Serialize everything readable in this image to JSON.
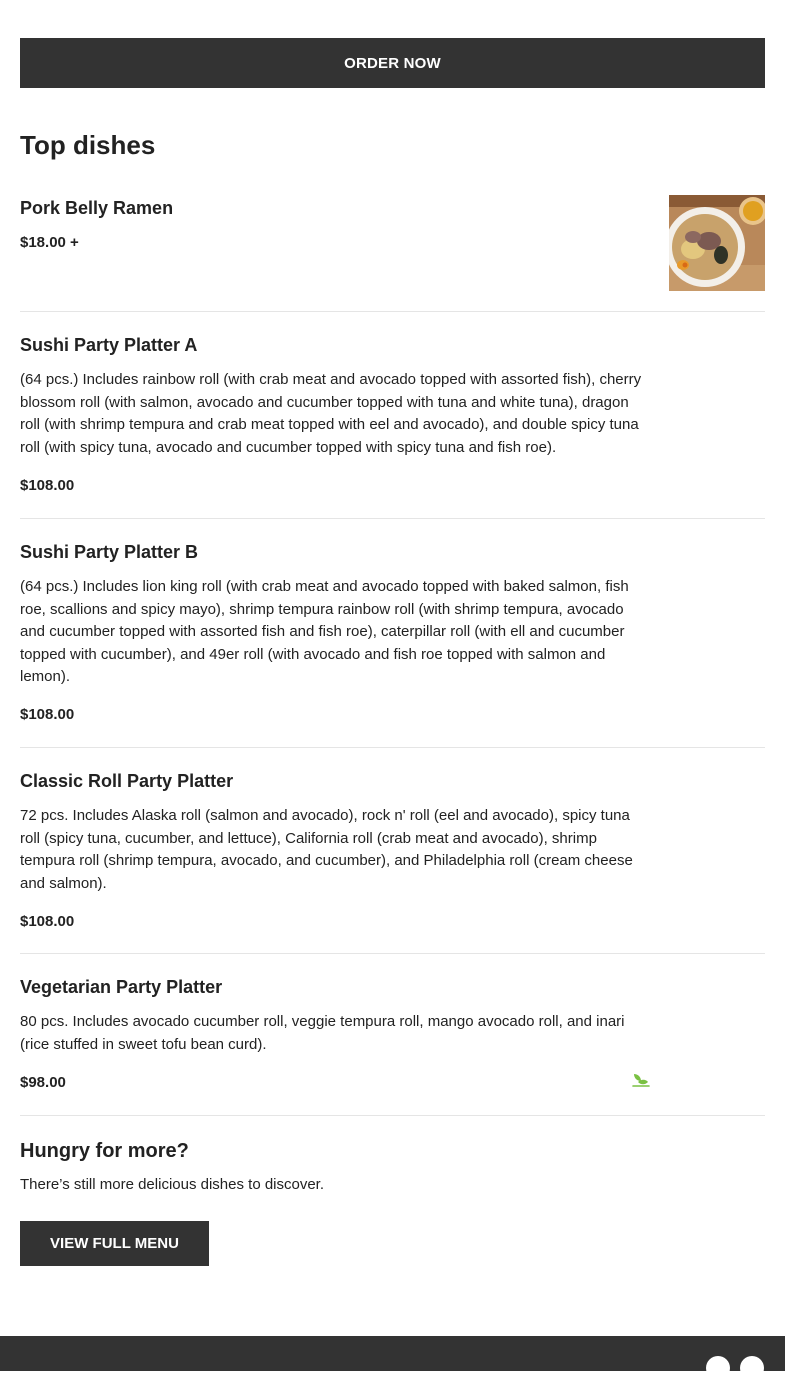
{
  "order_button": {
    "label": "ORDER NOW"
  },
  "top_dishes": {
    "title": "Top dishes",
    "items": [
      {
        "name": "Pork Belly Ramen",
        "description": "",
        "price": "$18.00 +"
      },
      {
        "name": "Sushi Party Platter A",
        "description": "(64 pcs.) Includes rainbow roll (with crab meat and avocado topped with assorted fish), cherry blossom roll (with salmon, avocado and cucumber topped with tuna and white tuna), dragon roll (with shrimp tempura and crab meat topped with eel and avocado), and double spicy tuna roll (with spicy tuna, avocado and cucumber topped with spicy tuna and fish roe).",
        "price": "$108.00"
      },
      {
        "name": "Sushi Party Platter B",
        "description": "(64 pcs.) Includes lion king roll (with crab meat and avocado topped with baked salmon, fish roe, scallions and spicy mayo), shrimp tempura rainbow roll (with shrimp tempura, avocado and cucumber topped with assorted fish and fish roe), caterpillar roll (with ell and cucumber topped with cucumber), and 49er roll (with avocado and fish roe topped with salmon and lemon).",
        "price": "$108.00"
      },
      {
        "name": "Classic Roll Party Platter",
        "description": "72 pcs. Includes Alaska roll (salmon and avocado), rock n' roll (eel and avocado), spicy tuna roll (spicy tuna, cucumber, and lettuce), California roll (crab meat and avocado), shrimp tempura roll (shrimp tempura, avocado, and cucumber), and Philadelphia roll (cream cheese and salmon).",
        "price": "$108.00"
      },
      {
        "name": "Vegetarian Party Platter",
        "description": "80 pcs. Includes avocado cucumber roll, veggie tempura roll, mango avocado roll, and inari (rice stuffed in sweet tofu bean curd).",
        "price": "$98.00",
        "badge_icon": "vegetarian-leaf-icon"
      }
    ]
  },
  "more": {
    "title": "Hungry for more?",
    "text": "There’s still more delicious dishes to discover.",
    "button_label": "VIEW FULL MENU"
  },
  "colors": {
    "button_bg": "#333333",
    "footer_bg": "#333333",
    "veg_icon": "#7ac143",
    "divider": "#e5e5e5"
  }
}
